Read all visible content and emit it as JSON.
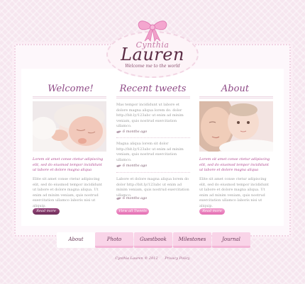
{
  "logo": {
    "script_small": "Cynthia",
    "script_big": "Lauren",
    "tagline": "Welcome me to the world"
  },
  "columns": {
    "welcome": {
      "title": "Welcome!",
      "pink_text": "Lorem sit amet conse ctetur adipiscing elit, sed do eiusmod tempor incididunt ut labore et dolore magna aliqua",
      "grey_text": "Elite sit amet conse ctetur adipiscing elit, sed do eiusmod tempor incididunt ut labore et dolore magna aliqua. Ut enim ad minim veniam, quis nostrud exercitation ullamco laboris nisi ut aliquip.",
      "button": "Read more"
    },
    "tweets": {
      "title": "Recent tweets",
      "items": [
        {
          "text": "Mas tempor incididunt ut labore et dolore magna aliqua lorem do. dolor http://bit.ly/123abc ut enim ad minim veniam, quis nostrud exercitation ullamco.",
          "time": "6 months ago"
        },
        {
          "text": "Magna aliqua lorem sit dolor http://bit.ly/123abc ut enim ad minim veniam, quis nostrud exercitation ullamco.",
          "time": "6 months ago"
        },
        {
          "text": "Labore et dolore magna aliqua lorem do dolor http://bit.ly/123abc ut enim ad minim veniam, quis nostrud exercitation ullamco.",
          "time": "6 months ago"
        }
      ],
      "button": "View all Tweets"
    },
    "about": {
      "title": "About",
      "pink_text": "Lorem sit amet conse ctetur adipiscing elit, sed do eiusmod tempor incididunt ut labore et dolore magna aliqua",
      "grey_text": "Elite sit amet conse ctetur adipiscing elit, sed do eiusmod tempor incididunt ut labore et dolore magna aliqua. Ut enim ad minim veniam, quis nostrud exercitation ullamco laboris nisi ut aliquip.",
      "button": "Read more"
    }
  },
  "nav": [
    "About",
    "Photo",
    "Guestbook",
    "Milestones",
    "Journal"
  ],
  "footer": {
    "copyright": "Cynthia Lauren © 2012",
    "privacy": "Privacy Policy"
  },
  "colors": {
    "background": "#f6e6ef",
    "heading": "#8e4a86",
    "accent_pink": "#b0478f"
  }
}
